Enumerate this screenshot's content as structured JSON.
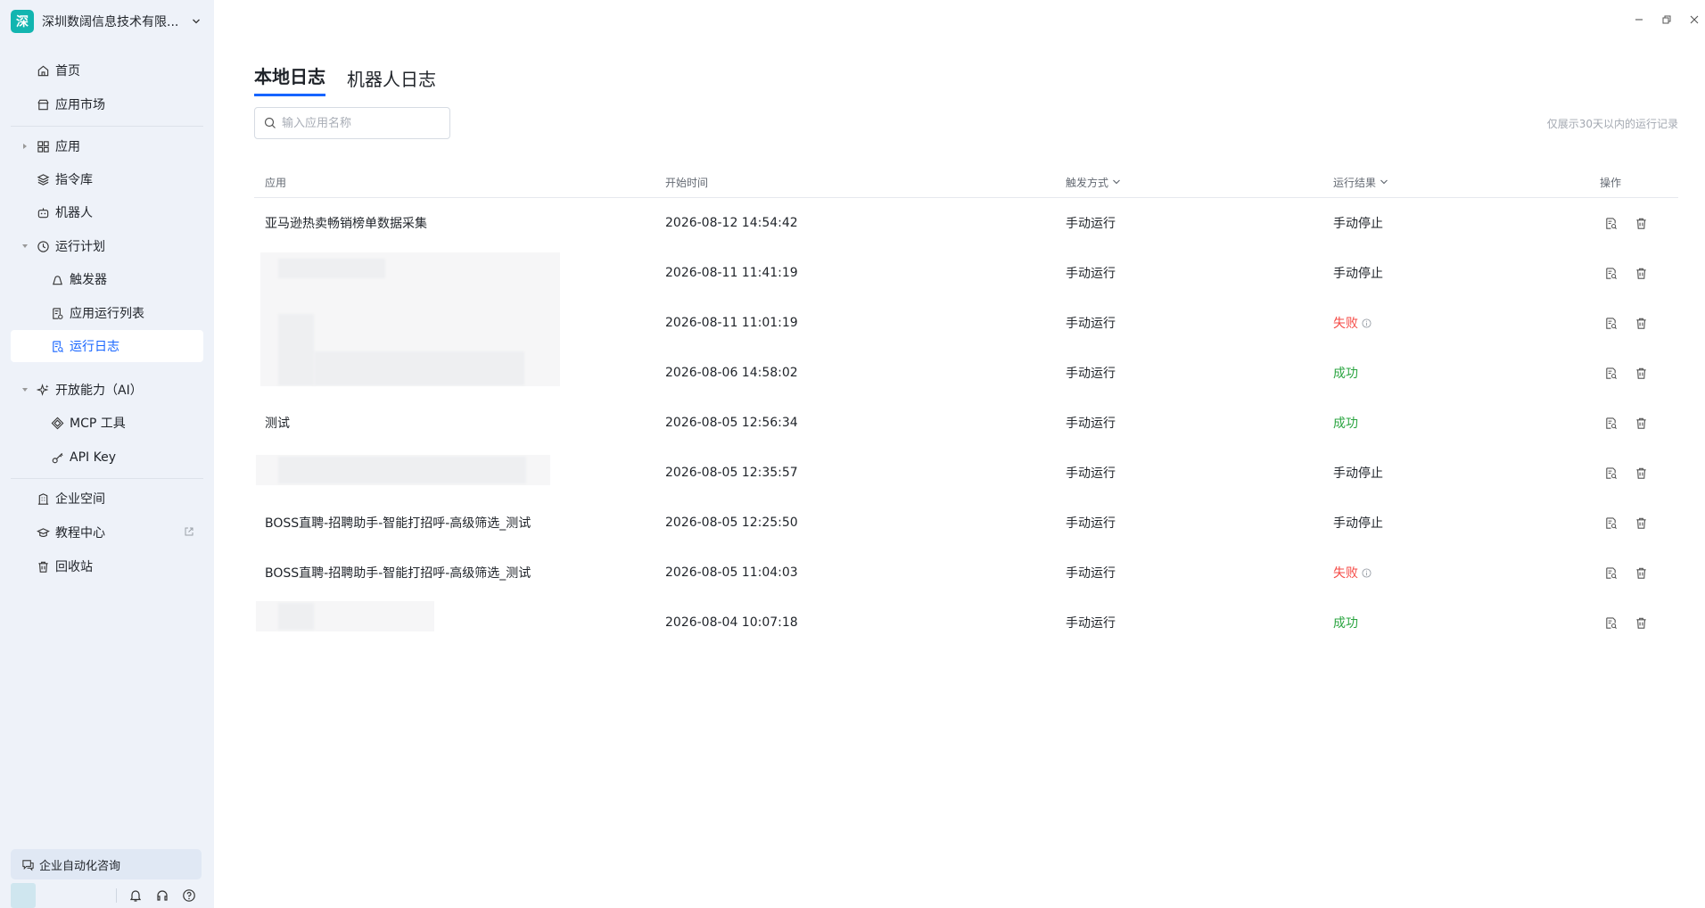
{
  "org": {
    "logo_char": "深",
    "name": "深圳数阔信息技术有限..."
  },
  "sidebar": {
    "home": "首页",
    "market": "应用市场",
    "apps": "应用",
    "commands": "指令库",
    "robots": "机器人",
    "schedule": "运行计划",
    "triggers": "触发器",
    "run_list": "应用运行列表",
    "run_log": "运行日志",
    "open_ai": "开放能力（AI）",
    "mcp": "MCP 工具",
    "api_key": "API Key",
    "enterprise": "企业空间",
    "tutorial": "教程中心",
    "trash": "回收站",
    "consult": "企业自动化咨询"
  },
  "tabs": [
    "本地日志",
    "机器人日志"
  ],
  "search": {
    "placeholder": "输入应用名称"
  },
  "hint": "仅展示30天以内的运行记录",
  "table": {
    "headers": {
      "app": "应用",
      "start": "开始时间",
      "trigger": "触发方式",
      "result": "运行结果",
      "ops": "操作"
    },
    "rows": [
      {
        "app": "亚马逊热卖畅销榜单数据采集",
        "start": "2026-08-12 14:54:42",
        "trigger": "手动运行",
        "result": "手动停止",
        "status": "stopped"
      },
      {
        "app": "",
        "start": "2026-08-11 11:41:19",
        "trigger": "手动运行",
        "result": "手动停止",
        "status": "stopped"
      },
      {
        "app": "",
        "start": "2026-08-11 11:01:19",
        "trigger": "手动运行",
        "result": "失败",
        "status": "fail"
      },
      {
        "app": "",
        "start": "2026-08-06 14:58:02",
        "trigger": "手动运行",
        "result": "成功",
        "status": "ok"
      },
      {
        "app": "测试",
        "start": "2026-08-05 12:56:34",
        "trigger": "手动运行",
        "result": "成功",
        "status": "ok"
      },
      {
        "app": "",
        "start": "2026-08-05 12:35:57",
        "trigger": "手动运行",
        "result": "手动停止",
        "status": "stopped"
      },
      {
        "app": "BOSS直聘-招聘助手-智能打招呼-高级筛选_测试",
        "start": "2026-08-05 12:25:50",
        "trigger": "手动运行",
        "result": "手动停止",
        "status": "stopped"
      },
      {
        "app": "BOSS直聘-招聘助手-智能打招呼-高级筛选_测试",
        "start": "2026-08-05 11:04:03",
        "trigger": "手动运行",
        "result": "失败",
        "status": "fail"
      },
      {
        "app": "",
        "start": "2026-08-04 10:07:18",
        "trigger": "手动运行",
        "result": "成功",
        "status": "ok"
      }
    ]
  },
  "colors": {
    "accent": "#1664ff",
    "fail": "#f54a45",
    "success": "#2ba541",
    "logo": "#12b5b0"
  }
}
